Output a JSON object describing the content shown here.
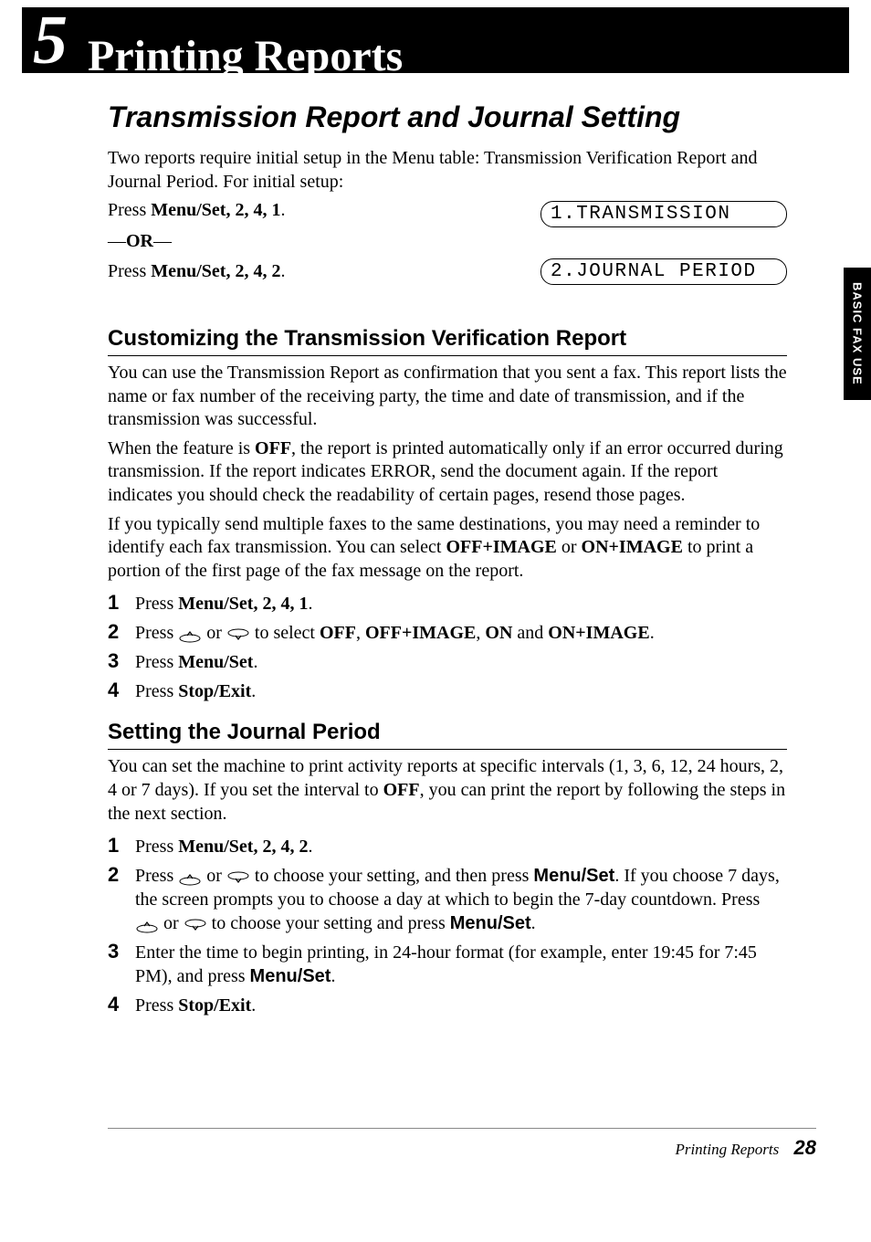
{
  "chapter": {
    "number": "5",
    "title": "Printing Reports"
  },
  "section_title": "Transmission Report and Journal Setting",
  "intro": "Two reports require initial setup in the Menu table: Transmission Verification Report and Journal Period. For initial setup:",
  "press1": {
    "prefix": "Press ",
    "keys": "Menu/Set",
    "seq": ", 2, 4, 1",
    "period": "."
  },
  "or": "—OR—",
  "press2": {
    "prefix": "Press ",
    "keys": "Menu/Set",
    "seq": ", 2, 4, 2",
    "period": "."
  },
  "lcd1": "1.TRANSMISSION",
  "lcd2": "2.JOURNAL PERIOD",
  "side_tab": "BASIC FAX USE",
  "sub1": {
    "heading": "Customizing the Transmission Verification Report",
    "p1": "You can use the Transmission Report as confirmation that you sent a fax. This report lists the name or fax number of the receiving party, the time and date of transmission, and if the transmission was successful.",
    "p2_a": "When the feature is ",
    "p2_off": "OFF",
    "p2_b": ", the report is printed automatically only if an error occurred during transmission. If the report indicates ERROR, send the document again. If the report indicates you should check the readability of certain pages, resend those pages.",
    "p3_a": "If you typically send multiple faxes to the same destinations, you may need a reminder to identify each fax transmission. You can select ",
    "p3_o1": "OFF+IMAGE",
    "p3_mid": " or ",
    "p3_o2": "ON+IMAGE",
    "p3_b": " to print a portion of the first page of the fax message on the report.",
    "steps": {
      "s1": {
        "a": "Press ",
        "k": "Menu/Set",
        "seq": ", 2, 4, 1",
        "p": "."
      },
      "s2": {
        "a": "Press ",
        "mid": " or ",
        "b": " to select ",
        "o1": "OFF",
        "c1": ", ",
        "o2": "OFF+IMAGE",
        "c2": ", ",
        "o3": "ON",
        "and": " and ",
        "o4": "ON+IMAGE",
        "p": "."
      },
      "s3": {
        "a": "Press ",
        "k": "Menu/Set",
        "p": "."
      },
      "s4": {
        "a": "Press ",
        "k": "Stop/Exit",
        "p": "."
      }
    }
  },
  "sub2": {
    "heading": "Setting the Journal Period",
    "p1_a": "You can set the machine to print activity reports at specific intervals (1, 3, 6, 12, 24 hours, 2, 4 or 7 days). If you set the interval to ",
    "p1_off": "OFF",
    "p1_b": ", you can print the report by following the steps in the next section.",
    "steps": {
      "s1": {
        "a": "Press ",
        "k": "Menu/Set",
        "seq": ", 2, 4, 2",
        "p": "."
      },
      "s2": {
        "a": "Press ",
        "mid": " or ",
        "b": " to choose your setting, and then press ",
        "k1": "Menu/Set",
        "c": ". If you choose 7 days, the screen prompts you to choose a day at which to begin the 7-day countdown. Press ",
        "mid2": " or ",
        "d": " to choose your setting and press ",
        "k2": "Menu/Set",
        "p": "."
      },
      "s3": {
        "a": "Enter the time to begin printing, in 24-hour format (for example, enter 19:45 for 7:45 PM), and press ",
        "k": "Menu/Set",
        "p": "."
      },
      "s4": {
        "a": "Press ",
        "k": "Stop/Exit",
        "p": "."
      }
    }
  },
  "footer": {
    "label": "Printing Reports",
    "page": "28"
  }
}
